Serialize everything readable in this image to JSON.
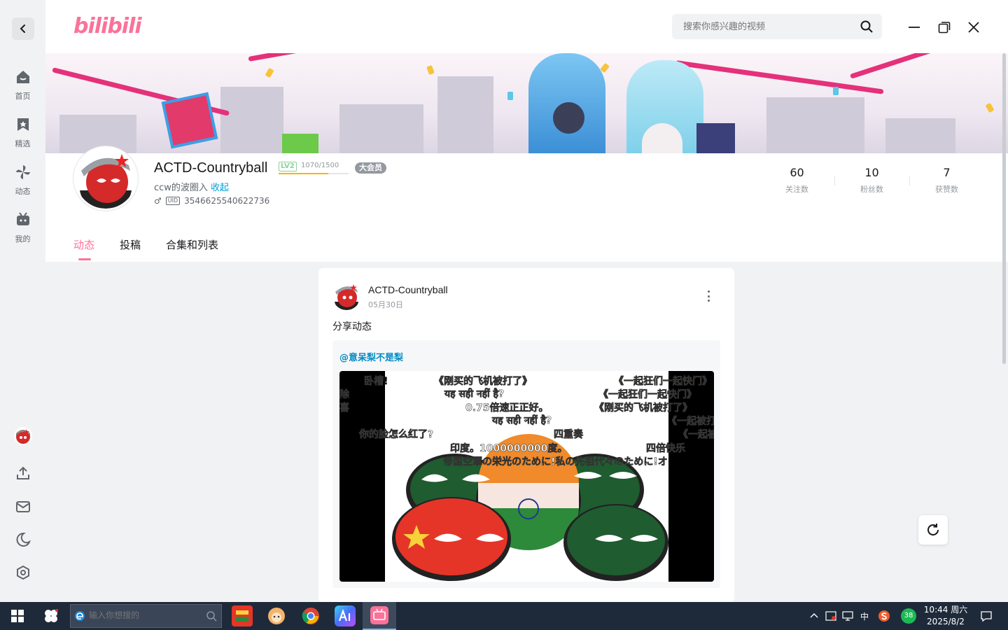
{
  "app": {
    "name": "bilibili"
  },
  "logo": {
    "text": "bilibili"
  },
  "search": {
    "placeholder": "搜索你感兴趣的视频"
  },
  "sidebar": {
    "items": [
      {
        "label": "首页",
        "icon": "home-icon"
      },
      {
        "label": "精选",
        "icon": "bookmark-icon"
      },
      {
        "label": "动态",
        "icon": "pinwheel-icon"
      },
      {
        "label": "我的",
        "icon": "tv-icon"
      }
    ],
    "bottom_icons": [
      "avatar",
      "upload-icon",
      "mail-icon",
      "moon-icon",
      "settings-icon"
    ]
  },
  "profile": {
    "username": "ACTD-Countryball",
    "level": "LV2",
    "exp": "1070/1500",
    "exp_fraction": 0.713,
    "vip": "大会员",
    "signature": "ccw的波圈入",
    "collapse": "收起",
    "gender_symbol": "♂",
    "uid_label": "UID",
    "uid": "3546625540622736",
    "stats": [
      {
        "num": "60",
        "label": "关注数"
      },
      {
        "num": "10",
        "label": "粉丝数"
      },
      {
        "num": "7",
        "label": "获赞数"
      }
    ],
    "tabs": [
      "动态",
      "投稿",
      "合集和列表"
    ],
    "active_tab": "动态"
  },
  "post": {
    "author": "ACTD-Countryball",
    "date": "05月30日",
    "text": "分享动态",
    "mention": "@意呆梨不是梨",
    "danmaku": [
      {
        "text": "卧槽!",
        "color": "#ffffff"
      },
      {
        "text": "除",
        "color": "#ffffff"
      },
      {
        "text": "喜",
        "color": "#3aa0ff"
      },
      {
        "text": "《刚买的飞机被打了》",
        "color": "#ffffff"
      },
      {
        "text": "यह सही नहीं है?",
        "color": "#ffffff"
      },
      {
        "text": "0.75倍速正正好。",
        "color": "#ffffff"
      },
      {
        "text": "यह सही नहीं है?",
        "color": "#ffffff"
      },
      {
        "text": "你的脸怎么红了?",
        "color": "#ffffff"
      },
      {
        "text": "四重奏",
        "color": "#ffffff"
      },
      {
        "text": "印度。1000000000度。",
        "color": "#ffffff"
      },
      {
        "text": "四倍快乐",
        "color": "#ffffff"
      },
      {
        "text": "帝国空軍の栄光のために!私の先祖代々のために!オ",
        "color": "#ffffff"
      },
      {
        "text": "《一起狂们一起快门》",
        "color": "#f7d23a"
      },
      {
        "text": "《一起狂们一起快门》",
        "color": "#ff4d6a"
      },
      {
        "text": "《刚买的飞机被打了》",
        "color": "#ffffff"
      },
      {
        "text": "《一起被打",
        "color": "#ffffff"
      },
      {
        "text": "《一起被",
        "color": "#3aa0ff"
      }
    ]
  },
  "taskbar": {
    "search_placeholder": "输入你想搜的",
    "ime": "中",
    "badge": "38",
    "time": "10:44 周六",
    "date": "2025/8/2"
  },
  "colors": {
    "brand": "#fb7299",
    "link": "#00a1d6",
    "taskbar": "#1e2a3a"
  }
}
